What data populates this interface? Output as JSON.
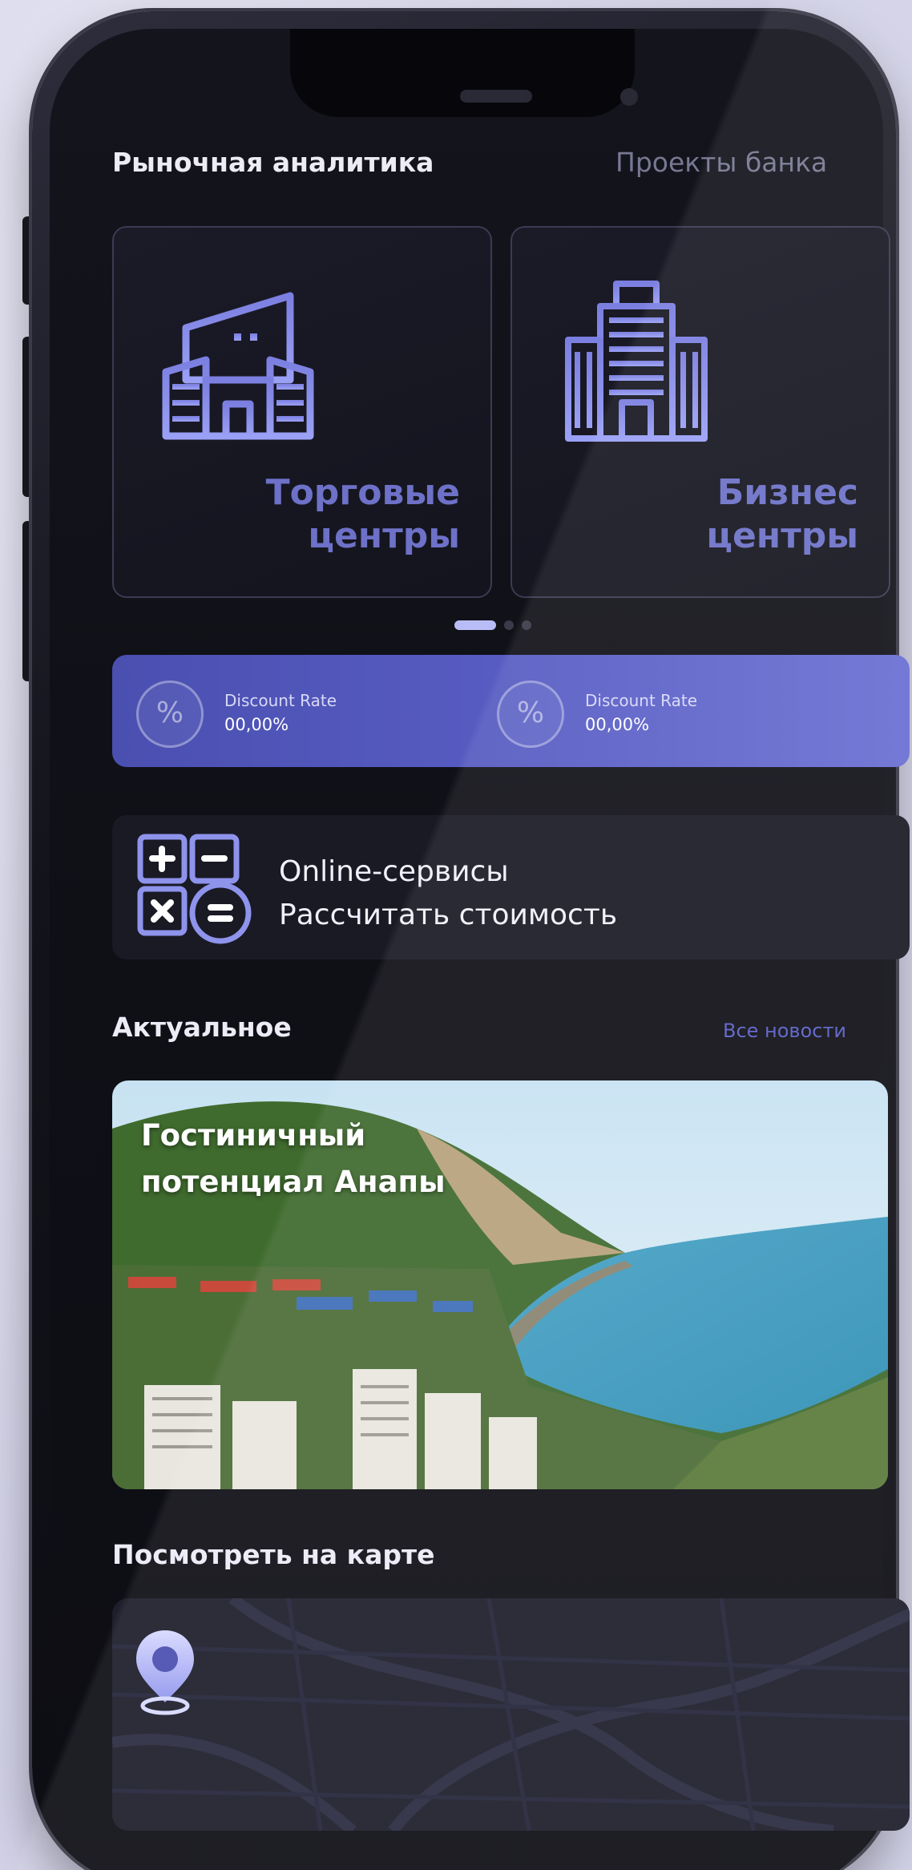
{
  "header": {
    "active_tab": "Рыночная аналитика",
    "inactive_tab": "Проекты банка"
  },
  "cards": [
    {
      "title_line1": "Торговые",
      "title_line2": "центры",
      "icon": "shopping-mall-icon"
    },
    {
      "title_line1": "Бизнес",
      "title_line2": "центры",
      "icon": "business-center-icon"
    }
  ],
  "carousel": {
    "active_index": 0,
    "count": 3
  },
  "rates": [
    {
      "label": "Discount Rate",
      "value": "00,00%",
      "icon": "percent-icon"
    },
    {
      "label": "Discount Rate",
      "value": "00,00%",
      "icon": "percent-icon"
    }
  ],
  "services": {
    "line1": "Online-сервисы",
    "line2": "Рассчитать стоимость",
    "icon": "calculator-icon"
  },
  "news": {
    "section_title": "Актуальное",
    "all_link": "Все новости",
    "item_title": "Гостиничный потенциал Анапы"
  },
  "map": {
    "section_title": "Посмотреть на карте",
    "icon": "map-pin-icon"
  },
  "colors": {
    "accent": "#5a5fc6",
    "card_title": "#6d71c7",
    "background": "#14141d"
  }
}
